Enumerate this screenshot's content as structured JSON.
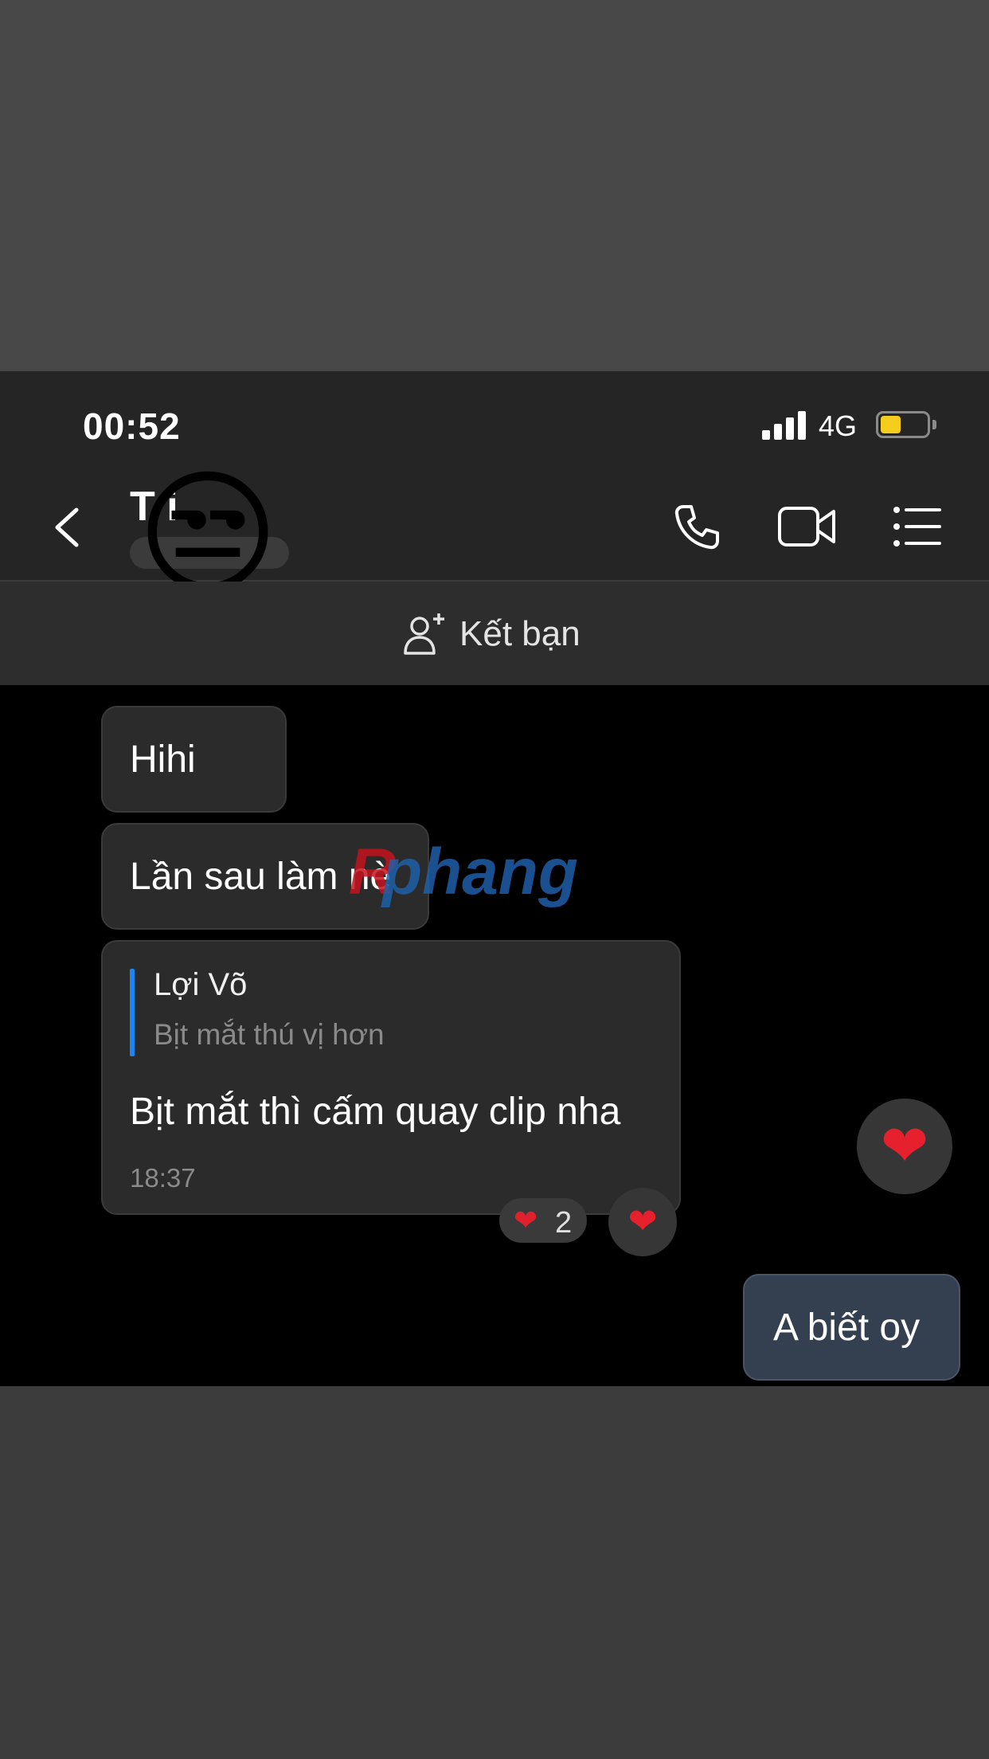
{
  "status_bar": {
    "time": "00:52",
    "network": "4G",
    "battery_level": 0.45
  },
  "header": {
    "contact_name": "T         i",
    "avatar_icon": "smirk-emoji",
    "actions": [
      "phone-icon",
      "video-icon",
      "list-menu-icon"
    ]
  },
  "friend_bar": {
    "label": "Kết bạn",
    "icon": "add-person-icon"
  },
  "conversation": {
    "sender_avatar": "squinting-tongue-emoji",
    "messages": [
      {
        "text": "Hihi"
      },
      {
        "text": "Lần sau làm nè"
      },
      {
        "quote": {
          "author": "Lợi Võ",
          "text": "Bịt mắt thú vị hơn"
        },
        "text": "Bịt mắt thì cấm quay clip nha",
        "time": "18:37",
        "reaction": {
          "icon": "heart",
          "count": "2"
        }
      }
    ],
    "outgoing": {
      "text": "A biết oy"
    }
  },
  "watermark": {
    "text": "phang",
    "logo_letter": "R"
  }
}
